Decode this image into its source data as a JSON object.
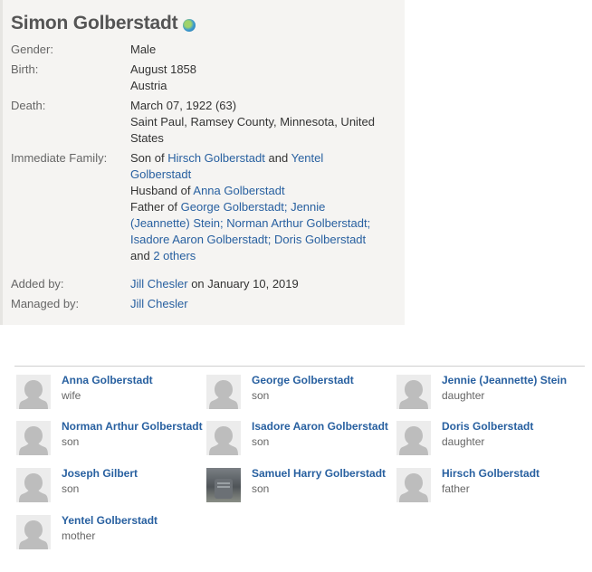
{
  "profile": {
    "name": "Simon Golberstadt",
    "gender_label": "Gender:",
    "gender": "Male",
    "birth_label": "Birth:",
    "birth_date": "August 1858",
    "birth_place": "Austria",
    "death_label": "Death:",
    "death_date": "March 07, 1922 (63)",
    "death_place_1": "Saint Paul, Ramsey County, Minnesota, United",
    "death_place_2": "States",
    "family_label": "Immediate Family:",
    "son_of_prefix": "Son of",
    "parent1": "Hirsch Golberstadt",
    "and_word": "and",
    "parent2_line1": "Yentel",
    "parent2_line2": "Golberstadt",
    "husband_prefix": "Husband of",
    "spouse": "Anna Golberstadt",
    "father_prefix": "Father of",
    "child1": "George Golberstadt;",
    "child2_line1": "Jennie",
    "child2_line2": "(Jeannette) Stein;",
    "child3": "Norman Arthur Golberstadt;",
    "child4": "Isadore Aaron Golberstadt;",
    "child5": "Doris Golberstadt",
    "others_prefix": "and",
    "others_link": "2 others",
    "added_label": "Added by:",
    "added_by": "Jill Chesler",
    "added_on": "on January 10, 2019",
    "managed_label": "Managed by:",
    "managed_by": "Jill Chesler"
  },
  "relatives": [
    {
      "name": "Anna Golberstadt",
      "relation": "wife",
      "photo": false
    },
    {
      "name": "George Golberstadt",
      "relation": "son",
      "photo": false
    },
    {
      "name": "Jennie (Jeannette) Stein",
      "relation": "daughter",
      "photo": false
    },
    {
      "name": "Norman Arthur Golberstadt",
      "relation": "son",
      "photo": false
    },
    {
      "name": "Isadore Aaron Golberstadt",
      "relation": "son",
      "photo": false
    },
    {
      "name": "Doris Golberstadt",
      "relation": "daughter",
      "photo": false
    },
    {
      "name": "Joseph Gilbert",
      "relation": "son",
      "photo": false
    },
    {
      "name": "Samuel Harry Golberstadt",
      "relation": "son",
      "photo": true
    },
    {
      "name": "Hirsch Golberstadt",
      "relation": "father",
      "photo": false
    },
    {
      "name": "Yentel Golberstadt",
      "relation": "mother",
      "photo": false
    }
  ],
  "colors": {
    "link": "#2860a0",
    "card_bg": "#f5f4f2"
  }
}
